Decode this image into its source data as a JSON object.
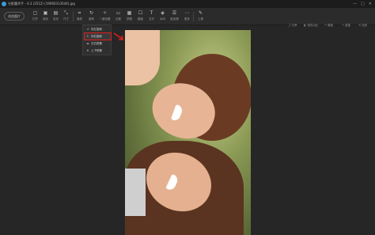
{
  "window": {
    "title": "光影魔术手 - 4:3 (2512) (19060313044).jpg",
    "minimize": "—",
    "maximize": "□",
    "close": "✕"
  },
  "toolbar": {
    "browse_label": "浏览图片",
    "tools": [
      {
        "icon": "folder-icon",
        "glyph": "▢",
        "label": "打开"
      },
      {
        "icon": "save-icon",
        "glyph": "▣",
        "label": "保存"
      },
      {
        "icon": "save-as-icon",
        "glyph": "▤",
        "label": "另存"
      },
      {
        "icon": "size-icon",
        "glyph": "⤡",
        "label": "尺寸"
      },
      {
        "icon": "crop-icon",
        "glyph": "⌗",
        "label": "裁剪"
      },
      {
        "icon": "rotate-icon",
        "glyph": "↻",
        "label": "旋转"
      },
      {
        "icon": "auto-icon",
        "glyph": "✧",
        "label": "一键设置"
      },
      {
        "icon": "frame-icon",
        "glyph": "▭",
        "label": "边框"
      },
      {
        "icon": "puzzle-icon",
        "glyph": "▦",
        "label": "拼图"
      },
      {
        "icon": "template-icon",
        "glyph": "☐",
        "label": "模板"
      },
      {
        "icon": "text-icon",
        "glyph": "T",
        "label": "文字"
      },
      {
        "icon": "watermark-icon",
        "glyph": "◈",
        "label": "水印"
      },
      {
        "icon": "batch-icon",
        "glyph": "☰",
        "label": "批处理"
      },
      {
        "icon": "more-icon",
        "glyph": "⋯",
        "label": "更多"
      },
      {
        "icon": "tools-icon",
        "glyph": "✎",
        "label": "工具"
      }
    ]
  },
  "sub_actions": {
    "share": "分享",
    "compare": "修改对比",
    "undo": "撤销",
    "redo": "重做",
    "restore": "还原"
  },
  "rotate_menu": {
    "items": [
      {
        "icon": "rotate-left-icon",
        "glyph": "↺",
        "label": "向左旋转"
      },
      {
        "icon": "rotate-right-icon",
        "glyph": "↻",
        "label": "向右旋转"
      },
      {
        "icon": "flip-horizontal-icon",
        "glyph": "◂▸",
        "label": "左右镜像"
      },
      {
        "icon": "flip-vertical-icon",
        "glyph": "⬍",
        "label": "上下镜像"
      }
    ],
    "highlighted_index": 1
  },
  "colors": {
    "highlight": "#e01e1e",
    "background": "#262626",
    "toolbar": "#2b2b2b"
  }
}
